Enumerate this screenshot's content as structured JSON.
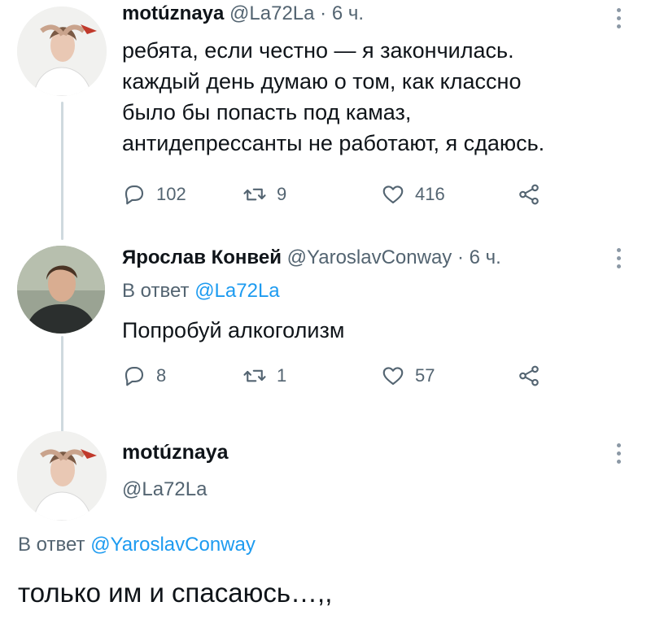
{
  "tweet1": {
    "author_name": "motúznaya",
    "handle": "@La72La",
    "separator": "·",
    "time": "6 ч.",
    "text": "ребята, если честно — я закончилась.\nкаждый день думаю о том, как классно\nбыло бы попасть под камаз,\nантидепрессанты не работают, я сдаюсь.",
    "replies": "102",
    "retweets": "9",
    "likes": "416"
  },
  "tweet2": {
    "author_name": "Ярослав Конвей",
    "handle": "@YaroslavConway",
    "separator": "·",
    "time": "6 ч.",
    "reply_prefix": "В ответ",
    "reply_to": "@La72La",
    "text": "Попробуй алкоголизм",
    "replies": "8",
    "retweets": "1",
    "likes": "57"
  },
  "focused": {
    "author_name": "motúznaya",
    "handle": "@La72La",
    "reply_prefix": "В ответ",
    "reply_to": "@YaroslavConway",
    "text": "только им и спасаюсь…,,"
  },
  "icons": [
    "more-icon",
    "reply-icon",
    "retweet-icon",
    "like-icon",
    "share-icon"
  ]
}
